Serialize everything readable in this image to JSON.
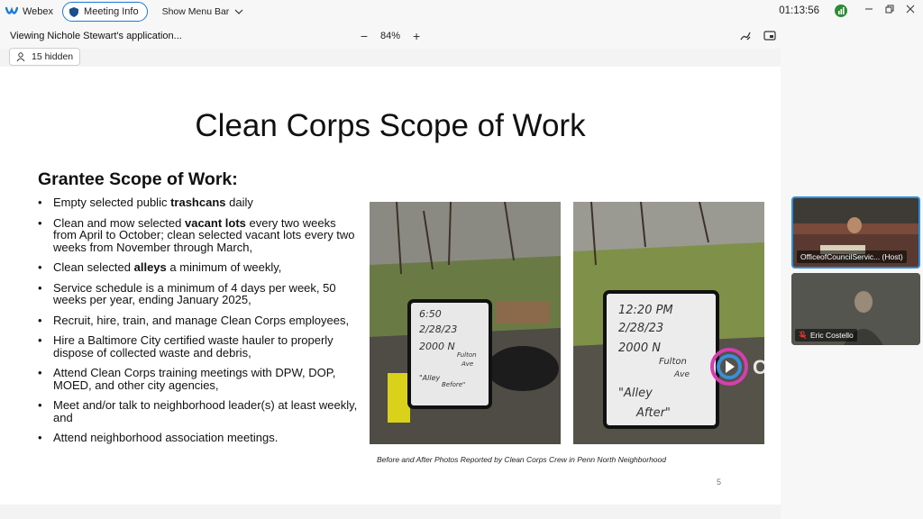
{
  "app": {
    "name": "Webex",
    "meeting_info_label": "Meeting Info",
    "menu_bar_label": "Show Menu Bar",
    "clock": "01:13:56"
  },
  "share_bar": {
    "viewing_text": "Viewing Nichole Stewart's application...",
    "zoom_out": "−",
    "zoom_level": "84%",
    "zoom_in": "+",
    "hidden_count_label": "15 hidden"
  },
  "slide": {
    "title": "Clean Corps Scope of Work",
    "section_heading": "Grantee Scope of Work:",
    "bullets": [
      {
        "pre": "Empty selected public ",
        "bold": "trashcans",
        "post": " daily"
      },
      {
        "pre": "Clean and mow selected ",
        "bold": "vacant lots",
        "post": " every two weeks from April to October; clean selected vacant lots every two weeks from November through March,"
      },
      {
        "pre": "Clean selected ",
        "bold": "alleys",
        "post": " a minimum of weekly,"
      },
      {
        "pre": "Service schedule is a minimum of 4 days per week, 50 weeks per year, ending January 2025,",
        "bold": "",
        "post": ""
      },
      {
        "pre": "Recruit, hire, train, and manage Clean Corps employees,",
        "bold": "",
        "post": ""
      },
      {
        "pre": "Hire a Baltimore City certified waste hauler to properly dispose of collected waste and debris,",
        "bold": "",
        "post": ""
      },
      {
        "pre": "Attend Clean Corps training meetings with DPW, DOP, MOED, and other city agencies,",
        "bold": "",
        "post": ""
      },
      {
        "pre": "Meet and/or talk to neighborhood leader(s) at least weekly, and",
        "bold": "",
        "post": ""
      },
      {
        "pre": "Attend neighborhood association meetings.",
        "bold": "",
        "post": ""
      }
    ],
    "photo_before": {
      "line1": "6:50",
      "line2": "2/28/23",
      "line3": "2000 N",
      "line4": "Fulton",
      "line5": "Ave",
      "line6": "\"Alley",
      "line7": "Before\""
    },
    "photo_after": {
      "line1": "12:20 PM",
      "line2": "2/28/23",
      "line3": "2000 N",
      "line4": "Fulton",
      "line5": "Ave",
      "line6": "\"Alley",
      "line7": "After\""
    },
    "caption": "Before and After Photos Reported by Clean Corps Crew in Penn North Neighborhood",
    "page_number": "5",
    "watermark_text": "CHARM"
  },
  "participants": [
    {
      "name": "OfficeofCouncilServic... (Host)",
      "active_speaker": true
    },
    {
      "name": "Eric Costello",
      "muted": true
    }
  ],
  "colors": {
    "accent": "#1b7ad6",
    "active_border": "#2b8fe0",
    "muted_red": "#e0352b"
  }
}
